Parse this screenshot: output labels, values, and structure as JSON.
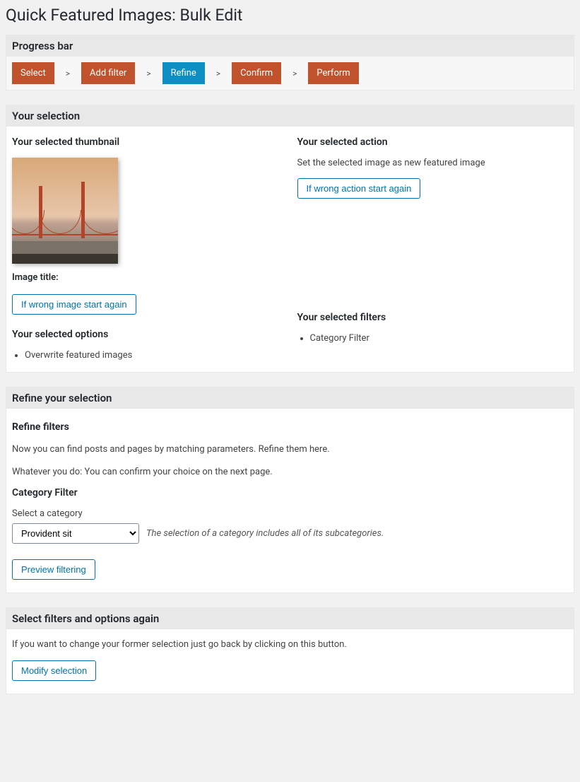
{
  "page_title": "Quick Featured Images: Bulk Edit",
  "progress": {
    "header": "Progress bar",
    "steps": [
      "Select",
      "Add filter",
      "Refine",
      "Confirm",
      "Perform"
    ],
    "active_index": 2,
    "separator": ">"
  },
  "selection": {
    "header": "Your selection",
    "thumbnail_heading": "Your selected thumbnail",
    "image_title_label": "Image title:",
    "wrong_image_btn": "If wrong image start again",
    "action_heading": "Your selected action",
    "action_desc": "Set the selected image as new featured image",
    "wrong_action_btn": "If wrong action start again",
    "options_heading": "Your selected options",
    "options": [
      "Overwrite featured images"
    ],
    "filters_heading": "Your selected filters",
    "filters": [
      "Category Filter"
    ]
  },
  "refine": {
    "header": "Refine your selection",
    "filters_sub": "Refine filters",
    "para1": "Now you can find posts and pages by matching parameters. Refine them here.",
    "para2": "Whatever you do: You can confirm your choice on the next page.",
    "cat_heading": "Category Filter",
    "cat_label": "Select a category",
    "cat_selected": "Provident sit",
    "cat_hint": "The selection of a category includes all of its subcategories.",
    "preview_btn": "Preview filtering"
  },
  "again": {
    "header": "Select filters and options again",
    "para": "If you want to change your former selection just go back by clicking on this button.",
    "modify_btn": "Modify selection"
  }
}
